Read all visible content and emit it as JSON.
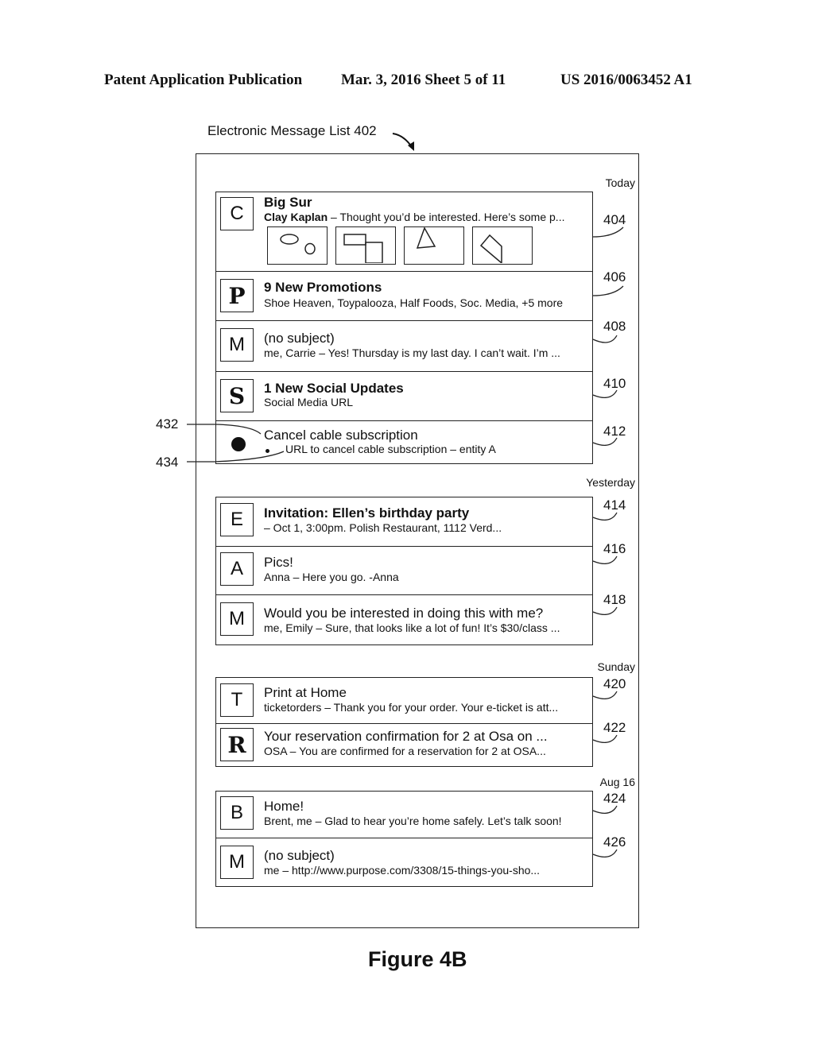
{
  "header": {
    "publication": "Patent Application Publication",
    "date_sheet": "Mar. 3, 2016   Sheet 5 of 11",
    "patent_number": "US 2016/0063452 A1"
  },
  "list_title": "Electronic Message List 402",
  "figure_label": "Figure 4B",
  "callouts": {
    "c432": "432",
    "c434": "434"
  },
  "groups": [
    {
      "date": "Today",
      "messages": [
        {
          "ref": "404",
          "avatar": "C",
          "subject": "Big Sur",
          "sender": "Clay Kaplan",
          "preview": " – Thought you’d be interested. Here’s some p...",
          "thumbnails": [
            "ellipse-and-circle",
            "overlapping-rectangles",
            "triangle",
            "pentagon"
          ]
        },
        {
          "ref": "406",
          "avatar": "P",
          "subject": "9 New Promotions",
          "preview": "Shoe Heaven, Toypalooza, Half Foods, Soc. Media, +5 more"
        },
        {
          "ref": "408",
          "avatar": "M",
          "subject": "(no subject)",
          "preview": "me, Carrie – Yes! Thursday is my last day. I can’t wait. I’m ..."
        },
        {
          "ref": "410",
          "avatar": "S",
          "subject": "1 New Social Updates",
          "preview": "Social Media URL"
        },
        {
          "ref": "412",
          "avatar": "●",
          "subject": "Cancel cable subscription",
          "preview": "URL to cancel cable subscription – entity A"
        }
      ]
    },
    {
      "date": "Yesterday",
      "messages": [
        {
          "ref": "414",
          "avatar": "E",
          "subject": "Invitation: Ellen’s birthday party",
          "preview": "– Oct 1, 3:00pm. Polish Restaurant, 1112 Verd..."
        },
        {
          "ref": "416",
          "avatar": "A",
          "subject": "Pics!",
          "preview": "Anna – Here you go. -Anna"
        },
        {
          "ref": "418",
          "avatar": "M",
          "subject": "Would you be interested in doing this with me?",
          "preview": "me, Emily – Sure, that looks like a lot of fun! It’s $30/class ..."
        }
      ]
    },
    {
      "date": "Sunday",
      "messages": [
        {
          "ref": "420",
          "avatar": "T",
          "subject": "Print at Home",
          "preview": "ticketorders – Thank you for your order. Your e-ticket is att..."
        },
        {
          "ref": "422",
          "avatar": "R",
          "subject": "Your reservation confirmation for 2 at Osa on ...",
          "preview": "OSA – You are confirmed for a reservation for 2 at OSA..."
        }
      ]
    },
    {
      "date": "Aug 16",
      "messages": [
        {
          "ref": "424",
          "avatar": "B",
          "subject": "Home!",
          "preview": "Brent, me – Glad to hear you’re home safely. Let’s talk soon!"
        },
        {
          "ref": "426",
          "avatar": "M",
          "subject": "(no subject)",
          "preview": "me – http://www.purpose.com/3308/15-things-you-sho..."
        }
      ]
    }
  ]
}
